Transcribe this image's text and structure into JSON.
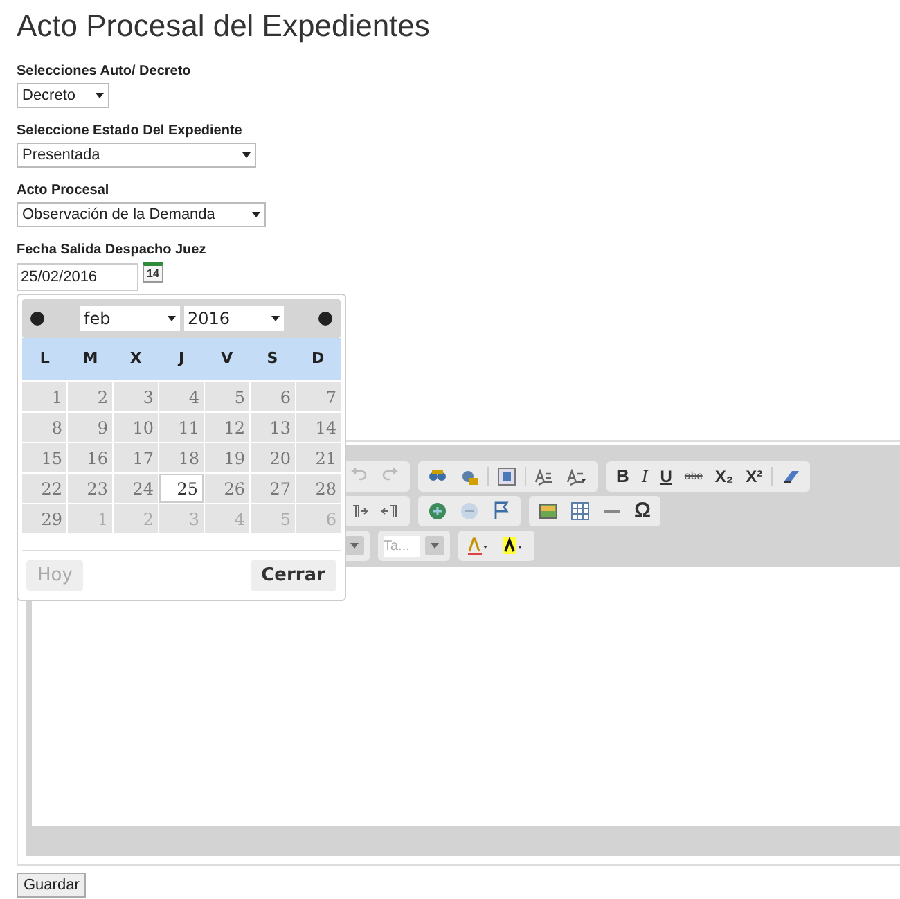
{
  "title": "Acto Procesal del Expedientes",
  "fields": [
    {
      "kind": "select",
      "label": "Selecciones Auto/ Decreto",
      "value": "Decreto"
    },
    {
      "kind": "select",
      "label": "Seleccione Estado Del Expediente",
      "value": "Presentada"
    },
    {
      "kind": "select",
      "label": "Acto Procesal",
      "value": "Observación de la Demanda"
    },
    {
      "kind": "date",
      "label": "Fecha Salida Despacho Juez",
      "value": "25/02/2016",
      "icon_text": "14"
    }
  ],
  "datepicker": {
    "month": "feb",
    "year": "2016",
    "weekdays": [
      "L",
      "M",
      "X",
      "J",
      "V",
      "S",
      "D"
    ],
    "weeks": [
      [
        {
          "day": "1",
          "selected": false,
          "muted": false
        },
        {
          "day": "2",
          "selected": false,
          "muted": false
        },
        {
          "day": "3",
          "selected": false,
          "muted": false
        },
        {
          "day": "4",
          "selected": false,
          "muted": false
        },
        {
          "day": "5",
          "selected": false,
          "muted": false
        },
        {
          "day": "6",
          "selected": false,
          "muted": false
        },
        {
          "day": "7",
          "selected": false,
          "muted": false
        }
      ],
      [
        {
          "day": "8",
          "selected": false,
          "muted": false
        },
        {
          "day": "9",
          "selected": false,
          "muted": false
        },
        {
          "day": "10",
          "selected": false,
          "muted": false
        },
        {
          "day": "11",
          "selected": false,
          "muted": false
        },
        {
          "day": "12",
          "selected": false,
          "muted": false
        },
        {
          "day": "13",
          "selected": false,
          "muted": false
        },
        {
          "day": "14",
          "selected": false,
          "muted": false
        }
      ],
      [
        {
          "day": "15",
          "selected": false,
          "muted": false
        },
        {
          "day": "16",
          "selected": false,
          "muted": false
        },
        {
          "day": "17",
          "selected": false,
          "muted": false
        },
        {
          "day": "18",
          "selected": false,
          "muted": false
        },
        {
          "day": "19",
          "selected": false,
          "muted": false
        },
        {
          "day": "20",
          "selected": false,
          "muted": false
        },
        {
          "day": "21",
          "selected": false,
          "muted": false
        }
      ],
      [
        {
          "day": "22",
          "selected": false,
          "muted": false
        },
        {
          "day": "23",
          "selected": false,
          "muted": false
        },
        {
          "day": "24",
          "selected": false,
          "muted": false
        },
        {
          "day": "25",
          "selected": true,
          "muted": false
        },
        {
          "day": "26",
          "selected": false,
          "muted": false
        },
        {
          "day": "27",
          "selected": false,
          "muted": false
        },
        {
          "day": "28",
          "selected": false,
          "muted": false
        }
      ],
      [
        {
          "day": "29",
          "selected": false,
          "muted": false
        },
        {
          "day": "1",
          "selected": false,
          "muted": true
        },
        {
          "day": "2",
          "selected": false,
          "muted": true
        },
        {
          "day": "3",
          "selected": false,
          "muted": true
        },
        {
          "day": "4",
          "selected": false,
          "muted": true
        },
        {
          "day": "5",
          "selected": false,
          "muted": true
        },
        {
          "day": "6",
          "selected": false,
          "muted": true
        }
      ]
    ],
    "today_button": {
      "label": "Hoy",
      "disabled": true
    },
    "close_button": {
      "label": "Cerrar",
      "disabled": false
    }
  },
  "editor": {
    "toolbar_rows": [
      [
        [
          {
            "kind": "undo"
          },
          {
            "kind": "redo"
          }
        ],
        [
          {
            "kind": "find"
          },
          {
            "kind": "replace"
          },
          {
            "kind": "sep"
          },
          {
            "kind": "selectall"
          },
          {
            "kind": "sep"
          },
          {
            "kind": "spell"
          },
          {
            "kind": "spellmenu"
          }
        ],
        [
          {
            "kind": "bold",
            "label": "B"
          },
          {
            "kind": "italic",
            "label": "I"
          },
          {
            "kind": "underline",
            "label": "U"
          },
          {
            "kind": "strike",
            "label": "abc"
          },
          {
            "kind": "sub",
            "label": "X₂"
          },
          {
            "kind": "sup",
            "label": "X²"
          },
          {
            "kind": "sep"
          },
          {
            "kind": "eraser"
          }
        ]
      ],
      [
        [
          {
            "kind": "ltr"
          },
          {
            "kind": "rtl"
          }
        ],
        [
          {
            "kind": "link"
          },
          {
            "kind": "unlink"
          },
          {
            "kind": "anchor"
          }
        ],
        [
          {
            "kind": "image"
          },
          {
            "kind": "table"
          },
          {
            "kind": "hr"
          },
          {
            "kind": "omega",
            "label": "Ω"
          }
        ]
      ],
      [
        [
          {
            "kind": "combo"
          }
        ],
        [
          {
            "kind": "combo",
            "label": "Ta..."
          }
        ],
        [
          {
            "kind": "textcolor"
          },
          {
            "kind": "bgcolor"
          }
        ]
      ]
    ]
  },
  "save_button": "Guardar"
}
